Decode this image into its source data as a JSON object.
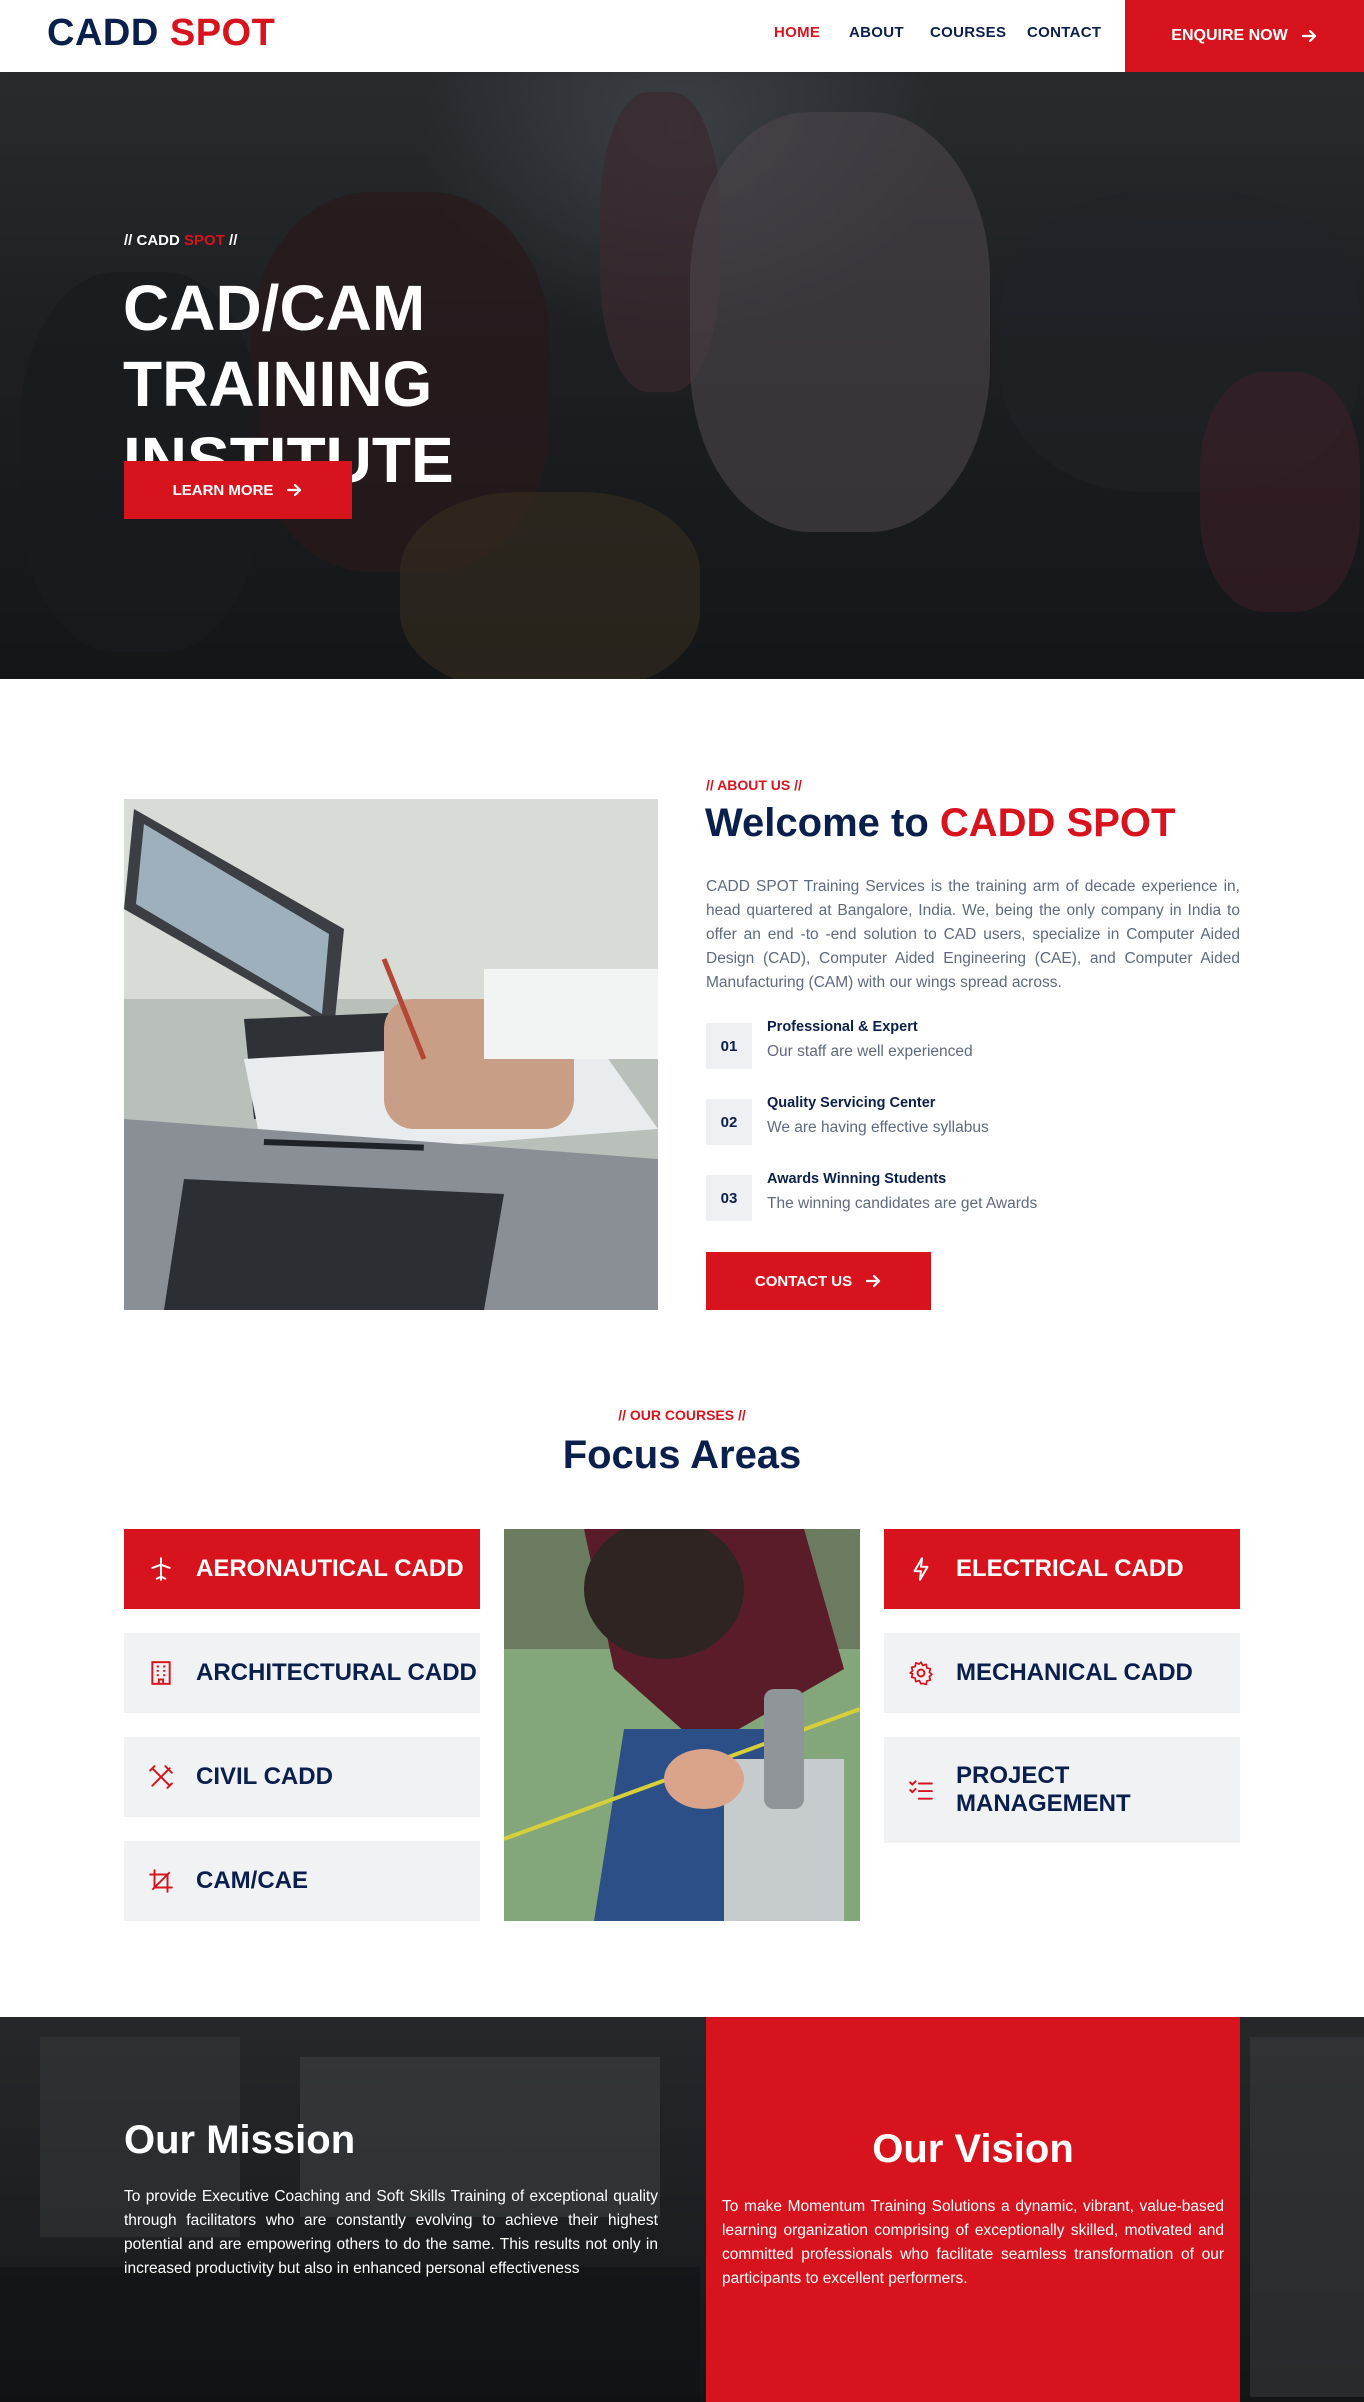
{
  "header": {
    "logo_part1": "CADD",
    "logo_part2": "SPOT",
    "nav": [
      "HOME",
      "ABOUT",
      "COURSES",
      "CONTACT"
    ],
    "active_nav": "HOME",
    "enquire_label": "ENQUIRE NOW"
  },
  "hero": {
    "tag_prefix": "// CADD",
    "tag_highlight": "SPOT",
    "tag_suffix": "//",
    "title": "CAD/CAM TRAINING INSTITUTE",
    "button_label": "LEARN MORE"
  },
  "about": {
    "tag": "// ABOUT US //",
    "title_prefix": "Welcome to",
    "title_highlight": "CADD SPOT",
    "text": "CADD SPOT Training Services is the training arm of decade experience in, head quartered at Bangalore, India. We, being the only company in India to offer an end -to -end solution to CAD users, specialize in Computer Aided Design (CAD), Computer Aided Engineering (CAE), and Computer Aided Manufacturing (CAM) with our wings spread across.",
    "features": [
      {
        "num": "01",
        "title": "Professional & Expert",
        "desc": "Our staff are well experienced"
      },
      {
        "num": "02",
        "title": "Quality Servicing Center",
        "desc": "We are having effective syllabus"
      },
      {
        "num": "03",
        "title": "Awards Winning Students",
        "desc": "The winning candidates are get Awards"
      }
    ],
    "button_label": "CONTACT US"
  },
  "courses": {
    "tag": "// OUR COURSES //",
    "title": "Focus Areas",
    "left": [
      {
        "label": "AERONAUTICAL CADD",
        "icon": "airplane-icon"
      },
      {
        "label": "ARCHITECTURAL CADD",
        "icon": "building-icon"
      },
      {
        "label": "CIVIL CADD",
        "icon": "tools-icon"
      },
      {
        "label": "CAM/CAE",
        "icon": "crop-icon"
      }
    ],
    "right": [
      {
        "label": "ELECTRICAL CADD",
        "icon": "lightning-icon"
      },
      {
        "label": "MECHANICAL CADD",
        "icon": "gear-icon"
      },
      {
        "label": "PROJECT MANAGEMENT",
        "icon": "checklist-icon"
      }
    ]
  },
  "mission": {
    "title": "Our Mission",
    "text": "To provide Executive Coaching and Soft Skills Training of exceptional quality through facilitators who are constantly evolving to achieve their highest potential and are empowering others to do the same. This results not only in increased productivity but also in enhanced personal effectiveness"
  },
  "vision": {
    "title": "Our Vision",
    "text": "To make Momentum Training Solutions a dynamic, vibrant, value-based learning organization comprising of exceptionally skilled, motivated and committed professionals who facilitate seamless transformation of our participants to excellent performers."
  },
  "colors": {
    "brand_red": "#d7141e",
    "brand_navy": "#0b1f4d",
    "card_gray": "#f1f2f4",
    "body_text": "#5e6a7e"
  }
}
